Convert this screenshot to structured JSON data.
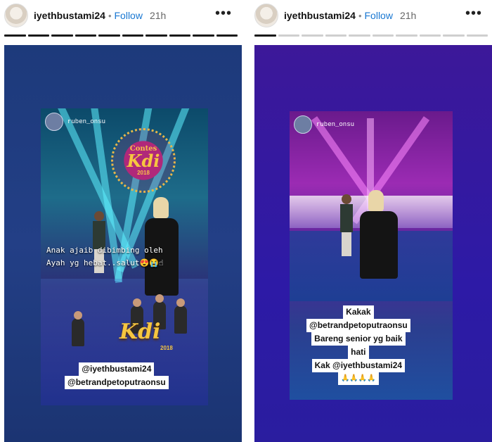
{
  "stories": [
    {
      "header": {
        "username": "iyethbustami24",
        "separator": "•",
        "follow_label": "Follow",
        "time": "21h",
        "more_label": "•••"
      },
      "progress": {
        "segments": 10,
        "completed": 10
      },
      "shot": {
        "username": "ruben_onsu",
        "logo": {
          "top": "Contes",
          "main": "Kdi",
          "year": "2018"
        },
        "caption_lines": [
          "Anak ajaib dibimbing oleh",
          "Ayah yg hebat..salut😍😭☝"
        ],
        "promo": {
          "main": "Kdi",
          "year": "2018"
        },
        "mentions": [
          "@iyethbustami24",
          "@betrandpetoputraonsu"
        ]
      }
    },
    {
      "header": {
        "username": "iyethbustami24",
        "separator": "•",
        "follow_label": "Follow",
        "time": "21h",
        "more_label": "•••"
      },
      "progress": {
        "segments": 10,
        "completed": 1
      },
      "shot": {
        "username": "ruben_onsu",
        "caption_lines": [
          "Kakak",
          "@betrandpetoputraonsu",
          "Bareng senior yg baik",
          "hati",
          "Kak @iyethbustami24",
          "🙏🙏🙏🙏"
        ]
      }
    }
  ],
  "colors": {
    "follow": "#1877d2",
    "progress_done": "#1a1a1a",
    "progress_todo": "#cfcfcf"
  }
}
